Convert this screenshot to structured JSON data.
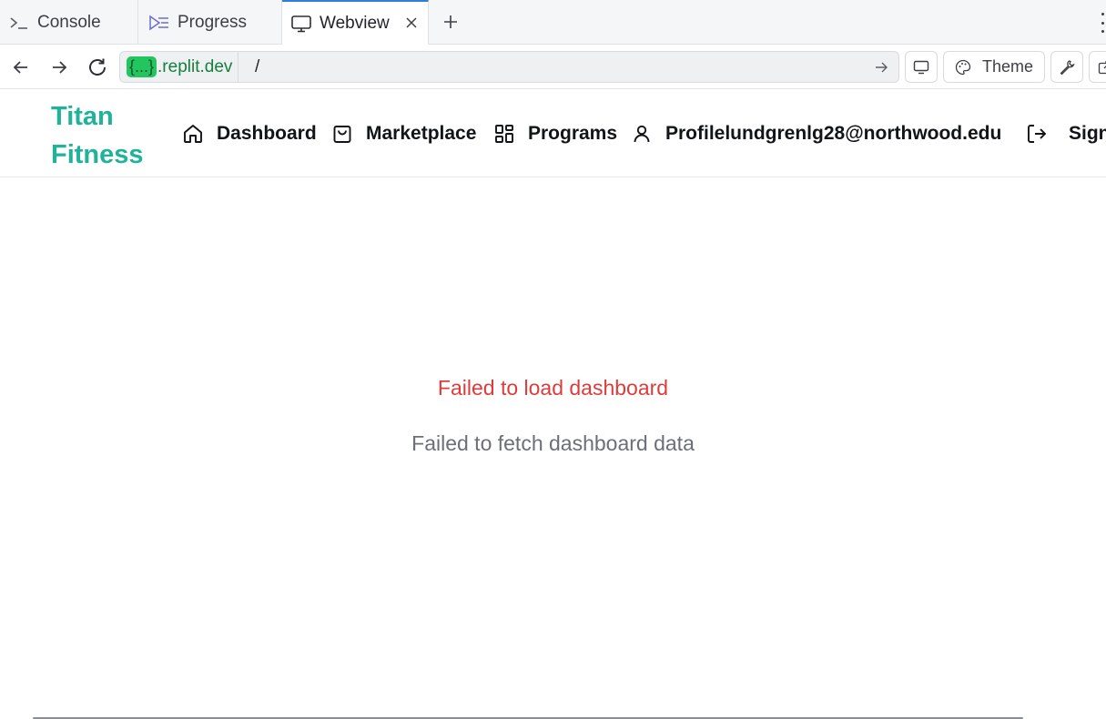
{
  "tabs": [
    {
      "label": "Console",
      "icon": "terminal-icon"
    },
    {
      "label": "Progress",
      "icon": "progress-icon"
    },
    {
      "label": "Webview",
      "icon": "monitor-icon",
      "active": true
    }
  ],
  "address": {
    "domain_badge": "{...}",
    "domain_suffix": ".replit.dev",
    "path": "/"
  },
  "toolbar": {
    "theme_label": "Theme"
  },
  "app": {
    "brand_line1": "Titan",
    "brand_line2": "Fitness",
    "brand_color": "#1fb39a",
    "nav": {
      "dashboard": "Dashboard",
      "marketplace": "Marketplace",
      "programs": "Programs",
      "profile": "Profilelundgrenlg28@northwood.edu",
      "signout": "Sign"
    }
  },
  "content": {
    "error_title": "Failed to load dashboard",
    "error_message": "Failed to fetch dashboard data",
    "error_color": "#e03b3b"
  }
}
